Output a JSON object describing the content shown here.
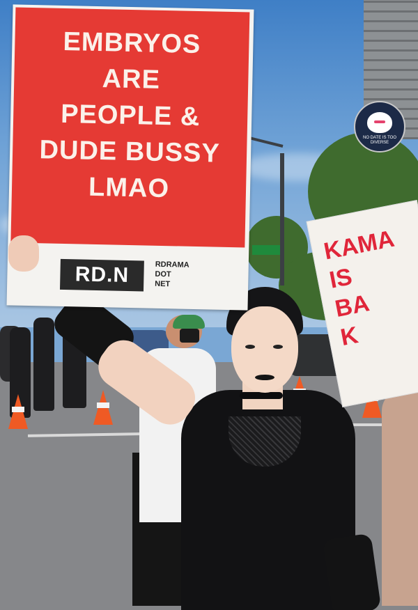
{
  "main_sign": {
    "lines": [
      "EMBRYOS",
      "ARE",
      "PEOPLE &",
      "DUDE BUSSY",
      "LMAO"
    ],
    "logo": "RD.N",
    "footer_lines": [
      "RDRAMA",
      "DOT",
      "NET"
    ]
  },
  "side_sign": {
    "lines": [
      "KAMA",
      "IS",
      "BA",
      "K"
    ]
  },
  "watermark_badge": {
    "text": "NO DATE IS TOO DIVERSE"
  },
  "colors": {
    "sign_red": "#e53a34",
    "sign_white": "#f4f3f0",
    "side_text_red": "#e0263a",
    "traffic_cone": "#ef5a24"
  }
}
